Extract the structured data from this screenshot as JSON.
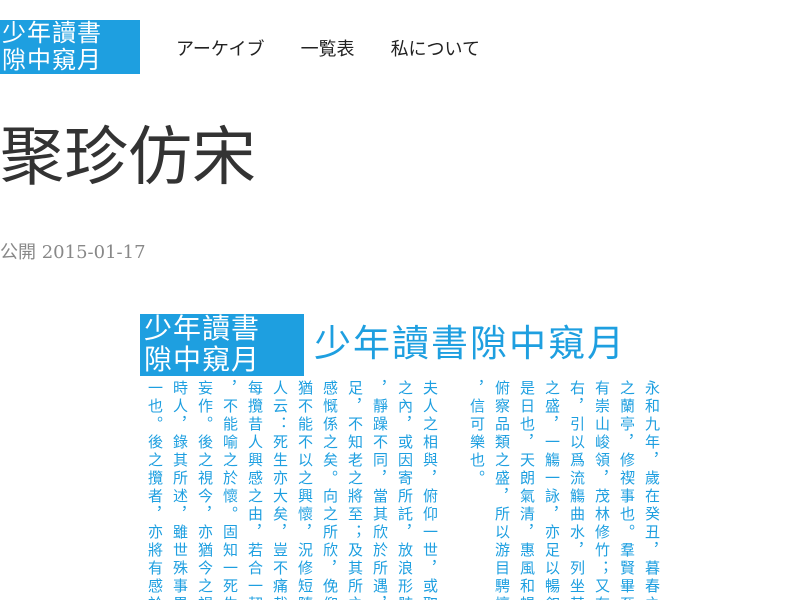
{
  "site": {
    "logo_line1": "少年讀書",
    "logo_line2": "隙中窺月"
  },
  "nav": {
    "items": [
      "アーケイブ",
      "一覧表",
      "私について"
    ]
  },
  "post": {
    "title": "聚珍仿宋",
    "published_label": "公開",
    "published_date": "2015-01-17"
  },
  "figure": {
    "logo_line1": "少年讀書",
    "logo_line2": "隙中窺月",
    "title": "少年讀書隙中窺月",
    "columns": [
      "永和九年，歲在癸丑，暮春之初，",
      "之蘭亭，修禊事也。羣賢畢至，少",
      "有崇山峻領，茂林修竹；又有清流",
      "右，引以爲流觴曲水，列坐其次。",
      "之盛，一觴一詠，亦足以暢叙幽情",
      "是日也，天朗氣清，惠風和暢。仰",
      "俯察品類之盛，所以游目騁懷，足",
      "，信可樂也。",
      "",
      "夫人之相與，俯仰一世，或取諸懷",
      "之內，或因寄所託，放浪形骸之外",
      "，靜躁不同，當其欣於所遇，暫得",
      "足，不知老之將至；及其所之既倦",
      "感慨係之矣。向之所欣，俛仰之間",
      "猶不能不以之興懷，況修短隨化，",
      "人云：死生亦大矣，豈不痛哉！",
      "每攬昔人興感之由，若合一契，未",
      "，不能喻之於懷。固知一死生爲虛",
      "妄作。後之視今，亦猶今之視昔，",
      "時人，錄其所述，雖世殊事異，所",
      "一也。後之攬者，亦將有感於斯文"
    ]
  },
  "colors": {
    "accent": "#1e9fe0",
    "text": "#333333",
    "meta": "#888888"
  }
}
